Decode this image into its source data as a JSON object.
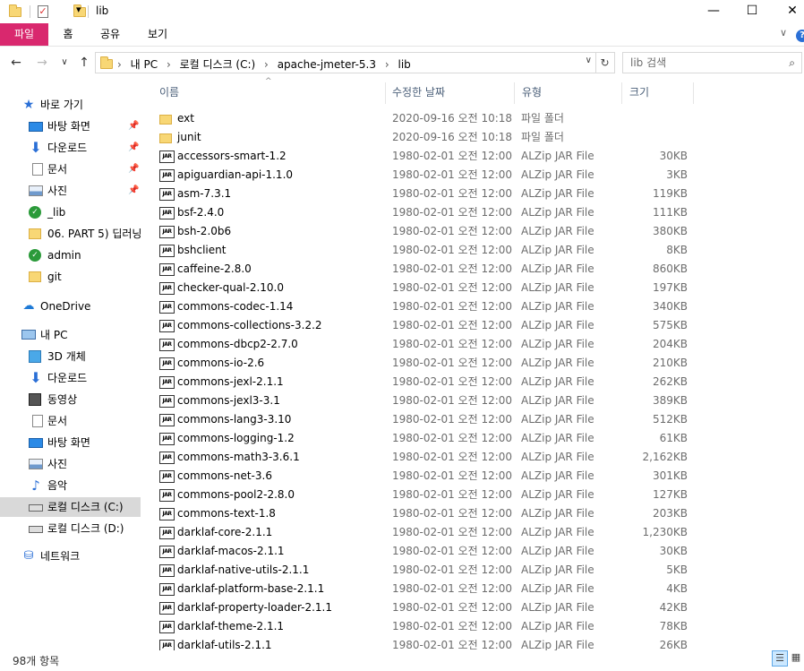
{
  "window": {
    "title": "lib",
    "minimize_glyph": "—",
    "maximize_glyph": "☐",
    "close_glyph": "✕"
  },
  "quick_access_dropdown": "▾",
  "ribbon": {
    "tabs": [
      "파일",
      "홈",
      "공유",
      "보기"
    ],
    "expand_glyph": "∨",
    "help_glyph": "?"
  },
  "nav": {
    "back": "←",
    "forward": "→",
    "recent": "∨",
    "up": "↑",
    "breadcrumb": [
      "내 PC",
      "로컬 디스크 (C:)",
      "apache-jmeter-5.3",
      "lib"
    ],
    "breadcrumb_sep": "›",
    "dropdown": "∨",
    "refresh": "↻",
    "search_placeholder": "lib 검색",
    "search_glyph": "⌕"
  },
  "sidebar": {
    "items": [
      {
        "label": "바로 가기",
        "icon": "star-icon",
        "glyph": "★",
        "pinned": false
      },
      {
        "label": "바탕 화면",
        "icon": "desktop-icon",
        "glyph": "",
        "pinned": true
      },
      {
        "label": "다운로드",
        "icon": "download-icon",
        "glyph": "⬇",
        "pinned": true
      },
      {
        "label": "문서",
        "icon": "document-icon",
        "glyph": "",
        "pinned": true
      },
      {
        "label": "사진",
        "icon": "pictures-icon",
        "glyph": "",
        "pinned": true
      },
      {
        "label": "_lib",
        "icon": "folder-sync-icon",
        "glyph": "✓",
        "pinned": false
      },
      {
        "label": "06. PART 5) 딥러닝",
        "icon": "folder-icon",
        "glyph": "",
        "pinned": false
      },
      {
        "label": "admin",
        "icon": "folder-sync-icon",
        "glyph": "✓",
        "pinned": false
      },
      {
        "label": "git",
        "icon": "folder-icon",
        "glyph": "",
        "pinned": false
      },
      {
        "label": "OneDrive",
        "icon": "onedrive-icon",
        "glyph": "☁",
        "pinned": false
      },
      {
        "label": "내 PC",
        "icon": "pc-icon",
        "glyph": "",
        "pinned": false
      },
      {
        "label": "3D 개체",
        "icon": "3d-objects-icon",
        "glyph": "",
        "pinned": false
      },
      {
        "label": "다운로드",
        "icon": "download-icon",
        "glyph": "⬇",
        "pinned": false
      },
      {
        "label": "동영상",
        "icon": "video-icon",
        "glyph": "",
        "pinned": false
      },
      {
        "label": "문서",
        "icon": "document-icon",
        "glyph": "",
        "pinned": false
      },
      {
        "label": "바탕 화면",
        "icon": "desktop-icon",
        "glyph": "",
        "pinned": false
      },
      {
        "label": "사진",
        "icon": "pictures-icon",
        "glyph": "",
        "pinned": false
      },
      {
        "label": "음악",
        "icon": "music-icon",
        "glyph": "♪",
        "pinned": false
      },
      {
        "label": "로컬 디스크 (C:)",
        "icon": "drive-c-icon",
        "glyph": "",
        "pinned": false
      },
      {
        "label": "로컬 디스크 (D:)",
        "icon": "drive-d-icon",
        "glyph": "",
        "pinned": false
      },
      {
        "label": "네트워크",
        "icon": "network-icon",
        "glyph": "⛁",
        "pinned": false
      }
    ],
    "pin_glyph": "📌",
    "selected_index": 18
  },
  "columns": {
    "name": "이름",
    "date": "수정한 날짜",
    "type": "유형",
    "size": "크기",
    "sort_glyph": "^"
  },
  "files": [
    {
      "name": "ext",
      "date": "2020-09-16 오전 10:18",
      "type": "파일 폴더",
      "size": "",
      "kind": "folder"
    },
    {
      "name": "junit",
      "date": "2020-09-16 오전 10:18",
      "type": "파일 폴더",
      "size": "",
      "kind": "folder"
    },
    {
      "name": "accessors-smart-1.2",
      "date": "1980-02-01 오전 12:00",
      "type": "ALZip JAR File",
      "size": "30KB",
      "kind": "jar"
    },
    {
      "name": "apiguardian-api-1.1.0",
      "date": "1980-02-01 오전 12:00",
      "type": "ALZip JAR File",
      "size": "3KB",
      "kind": "jar"
    },
    {
      "name": "asm-7.3.1",
      "date": "1980-02-01 오전 12:00",
      "type": "ALZip JAR File",
      "size": "119KB",
      "kind": "jar"
    },
    {
      "name": "bsf-2.4.0",
      "date": "1980-02-01 오전 12:00",
      "type": "ALZip JAR File",
      "size": "111KB",
      "kind": "jar"
    },
    {
      "name": "bsh-2.0b6",
      "date": "1980-02-01 오전 12:00",
      "type": "ALZip JAR File",
      "size": "380KB",
      "kind": "jar"
    },
    {
      "name": "bshclient",
      "date": "1980-02-01 오전 12:00",
      "type": "ALZip JAR File",
      "size": "8KB",
      "kind": "jar"
    },
    {
      "name": "caffeine-2.8.0",
      "date": "1980-02-01 오전 12:00",
      "type": "ALZip JAR File",
      "size": "860KB",
      "kind": "jar"
    },
    {
      "name": "checker-qual-2.10.0",
      "date": "1980-02-01 오전 12:00",
      "type": "ALZip JAR File",
      "size": "197KB",
      "kind": "jar"
    },
    {
      "name": "commons-codec-1.14",
      "date": "1980-02-01 오전 12:00",
      "type": "ALZip JAR File",
      "size": "340KB",
      "kind": "jar"
    },
    {
      "name": "commons-collections-3.2.2",
      "date": "1980-02-01 오전 12:00",
      "type": "ALZip JAR File",
      "size": "575KB",
      "kind": "jar"
    },
    {
      "name": "commons-dbcp2-2.7.0",
      "date": "1980-02-01 오전 12:00",
      "type": "ALZip JAR File",
      "size": "204KB",
      "kind": "jar"
    },
    {
      "name": "commons-io-2.6",
      "date": "1980-02-01 오전 12:00",
      "type": "ALZip JAR File",
      "size": "210KB",
      "kind": "jar"
    },
    {
      "name": "commons-jexl-2.1.1",
      "date": "1980-02-01 오전 12:00",
      "type": "ALZip JAR File",
      "size": "262KB",
      "kind": "jar"
    },
    {
      "name": "commons-jexl3-3.1",
      "date": "1980-02-01 오전 12:00",
      "type": "ALZip JAR File",
      "size": "389KB",
      "kind": "jar"
    },
    {
      "name": "commons-lang3-3.10",
      "date": "1980-02-01 오전 12:00",
      "type": "ALZip JAR File",
      "size": "512KB",
      "kind": "jar"
    },
    {
      "name": "commons-logging-1.2",
      "date": "1980-02-01 오전 12:00",
      "type": "ALZip JAR File",
      "size": "61KB",
      "kind": "jar"
    },
    {
      "name": "commons-math3-3.6.1",
      "date": "1980-02-01 오전 12:00",
      "type": "ALZip JAR File",
      "size": "2,162KB",
      "kind": "jar"
    },
    {
      "name": "commons-net-3.6",
      "date": "1980-02-01 오전 12:00",
      "type": "ALZip JAR File",
      "size": "301KB",
      "kind": "jar"
    },
    {
      "name": "commons-pool2-2.8.0",
      "date": "1980-02-01 오전 12:00",
      "type": "ALZip JAR File",
      "size": "127KB",
      "kind": "jar"
    },
    {
      "name": "commons-text-1.8",
      "date": "1980-02-01 오전 12:00",
      "type": "ALZip JAR File",
      "size": "203KB",
      "kind": "jar"
    },
    {
      "name": "darklaf-core-2.1.1",
      "date": "1980-02-01 오전 12:00",
      "type": "ALZip JAR File",
      "size": "1,230KB",
      "kind": "jar"
    },
    {
      "name": "darklaf-macos-2.1.1",
      "date": "1980-02-01 오전 12:00",
      "type": "ALZip JAR File",
      "size": "30KB",
      "kind": "jar"
    },
    {
      "name": "darklaf-native-utils-2.1.1",
      "date": "1980-02-01 오전 12:00",
      "type": "ALZip JAR File",
      "size": "5KB",
      "kind": "jar"
    },
    {
      "name": "darklaf-platform-base-2.1.1",
      "date": "1980-02-01 오전 12:00",
      "type": "ALZip JAR File",
      "size": "4KB",
      "kind": "jar"
    },
    {
      "name": "darklaf-property-loader-2.1.1",
      "date": "1980-02-01 오전 12:00",
      "type": "ALZip JAR File",
      "size": "42KB",
      "kind": "jar"
    },
    {
      "name": "darklaf-theme-2.1.1",
      "date": "1980-02-01 오전 12:00",
      "type": "ALZip JAR File",
      "size": "78KB",
      "kind": "jar"
    },
    {
      "name": "darklaf-utils-2.1.1",
      "date": "1980-02-01 오전 12:00",
      "type": "ALZip JAR File",
      "size": "26KB",
      "kind": "jar"
    }
  ],
  "jar_badge": "JAR",
  "status": {
    "item_count": "98개 항목",
    "details_view_glyph": "☰",
    "tiles_view_glyph": "▦"
  },
  "colors": {
    "file_tab": "#d9286e",
    "selection": "#d9d9d9",
    "header_text": "#4c607a",
    "secondary_text": "#6d6d6d"
  }
}
